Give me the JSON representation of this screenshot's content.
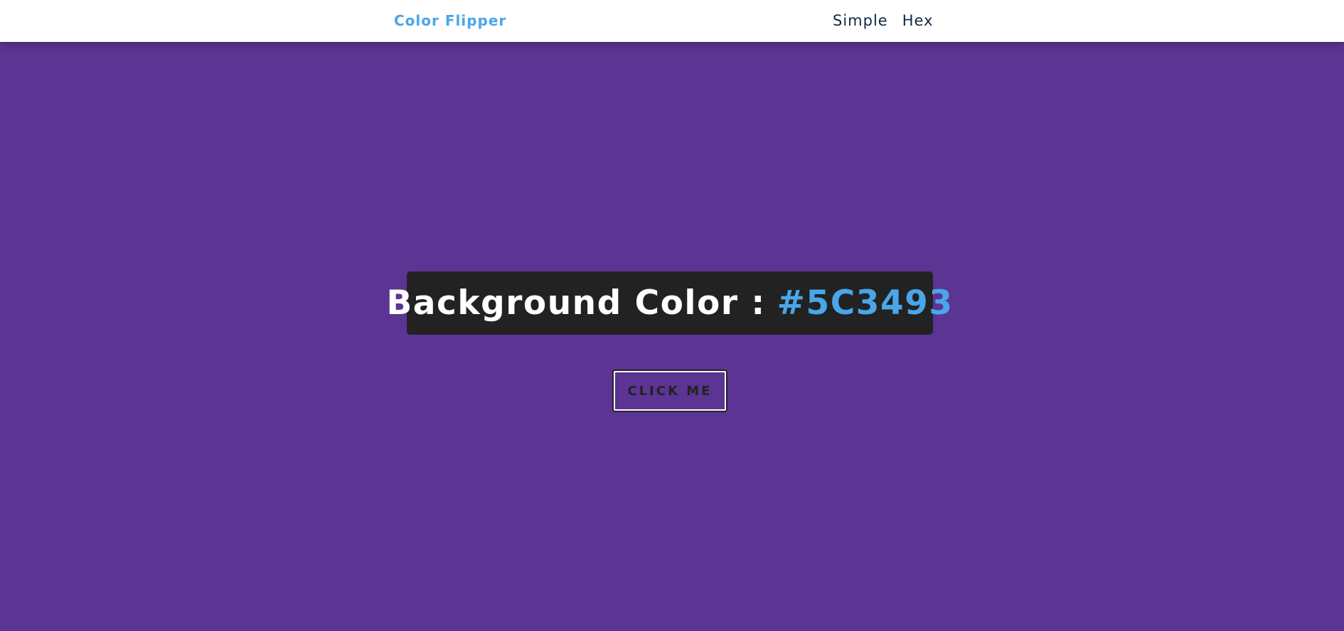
{
  "navbar": {
    "brand": "Color Flipper",
    "links": [
      {
        "label": "Simple"
      },
      {
        "label": "Hex"
      }
    ]
  },
  "main": {
    "label": "Background Color :",
    "color_value": "#5C3493",
    "button_label": "CLICK ME"
  },
  "colors": {
    "background": "#5C3493",
    "panel": "#222222",
    "accent": "#49A6E9",
    "nav_text": "#102A42",
    "navbar_bg": "#FFFFFF"
  }
}
